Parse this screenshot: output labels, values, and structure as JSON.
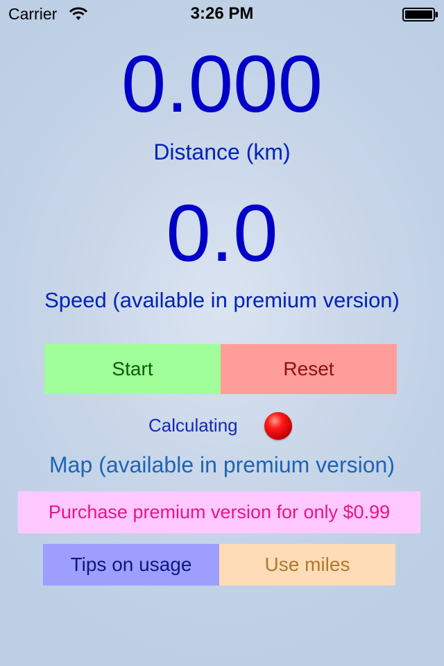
{
  "status_bar": {
    "carrier": "Carrier",
    "time": "3:26 PM"
  },
  "distance": {
    "value": "0.000",
    "label": "Distance (km)"
  },
  "speed": {
    "value": "0.0",
    "label": "Speed (available in premium version)"
  },
  "controls": {
    "start_label": "Start",
    "reset_label": "Reset"
  },
  "gps_status": {
    "label": "Calculating",
    "indicator_color": "#ff1a1a"
  },
  "map": {
    "label": "Map (available in premium version)"
  },
  "purchase": {
    "label": "Purchase premium version for only $0.99"
  },
  "footer": {
    "tips_label": "Tips on usage",
    "units_label": "Use miles"
  },
  "colors": {
    "value_text": "#0000c8",
    "start_bg": "#a0ff98",
    "reset_bg": "#ff9d9b",
    "purchase_bg": "#ffc8ff",
    "tips_bg": "#9e9eff",
    "miles_bg": "#ffdcb8"
  }
}
